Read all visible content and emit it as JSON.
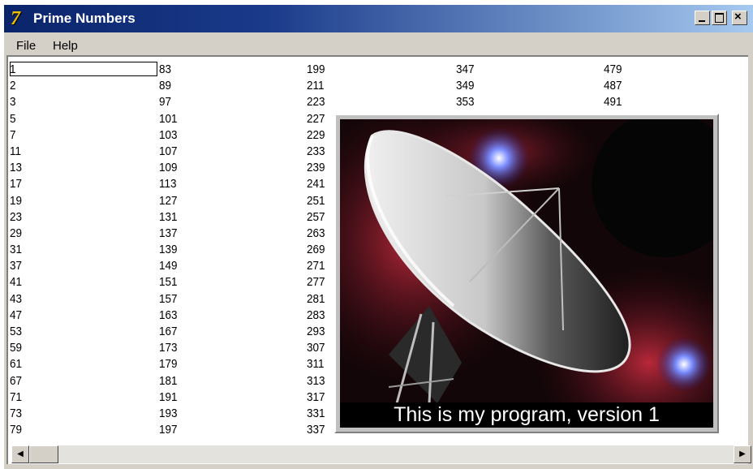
{
  "window": {
    "title": "Prime Numbers",
    "app_icon": "delphi-app-icon",
    "caption_buttons": {
      "minimize": "_",
      "maximize": "□",
      "close": "×"
    }
  },
  "menu": {
    "items": [
      "File",
      "Help"
    ]
  },
  "primes_columns": [
    [
      "1",
      "2",
      "3",
      "5",
      "7",
      "11",
      "13",
      "17",
      "19",
      "23",
      "29",
      "31",
      "37",
      "41",
      "43",
      "47",
      "53",
      "59",
      "61",
      "67",
      "71",
      "73",
      "79"
    ],
    [
      "83",
      "89",
      "97",
      "101",
      "103",
      "107",
      "109",
      "113",
      "127",
      "131",
      "137",
      "139",
      "149",
      "151",
      "157",
      "163",
      "167",
      "173",
      "179",
      "181",
      "191",
      "193",
      "197"
    ],
    [
      "199",
      "211",
      "223",
      "227",
      "229",
      "233",
      "239",
      "241",
      "251",
      "257",
      "263",
      "269",
      "271",
      "277",
      "281",
      "283",
      "293",
      "307",
      "311",
      "313",
      "317",
      "331",
      "337"
    ],
    [
      "347",
      "349",
      "353"
    ],
    [
      "479",
      "487",
      "491"
    ]
  ],
  "splash": {
    "caption": "This is my program, version 1",
    "image_subject": "radio-telescope-dish-space-image"
  },
  "scrollbar": {
    "left_arrow": "◀",
    "right_arrow": "▶"
  }
}
